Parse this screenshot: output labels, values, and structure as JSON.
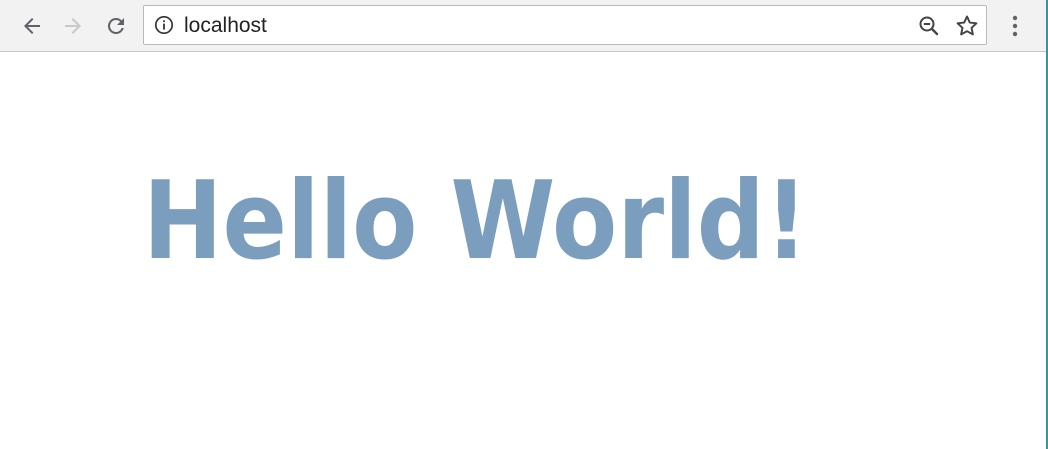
{
  "browser": {
    "address_bar": {
      "url": "localhost",
      "security_icon": "info-icon"
    },
    "nav": {
      "back_icon": "arrow-left-icon",
      "forward_icon": "arrow-right-icon",
      "reload_icon": "reload-icon",
      "forward_enabled": false
    },
    "actions": {
      "zoom_icon": "zoom-out-icon",
      "bookmark_icon": "star-icon",
      "menu_icon": "kebab-menu-icon"
    }
  },
  "page": {
    "headline": "Hello World!",
    "headline_color": "#7b9ebf"
  },
  "colors": {
    "toolbar_bg": "#f2f2f2",
    "icon": "#5f6368",
    "icon_disabled": "#c8c8c8",
    "window_edge": "#2a9d9a"
  }
}
